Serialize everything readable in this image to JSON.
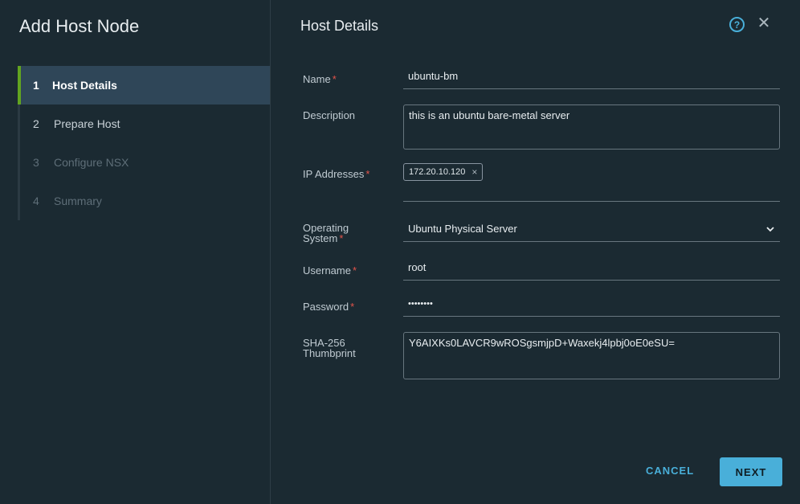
{
  "wizard": {
    "title": "Add Host Node",
    "steps": [
      {
        "num": "1",
        "label": "Host Details"
      },
      {
        "num": "2",
        "label": "Prepare Host"
      },
      {
        "num": "3",
        "label": "Configure NSX"
      },
      {
        "num": "4",
        "label": "Summary"
      }
    ]
  },
  "page": {
    "title": "Host Details",
    "help_glyph": "?",
    "close_glyph": "✕"
  },
  "form": {
    "name": {
      "label": "Name",
      "value": "ubuntu-bm",
      "required": "*"
    },
    "description": {
      "label": "Description",
      "value": "this is an ubuntu bare-metal server"
    },
    "ip_addresses": {
      "label": "IP Addresses",
      "required": "*",
      "chips": [
        "172.20.10.120"
      ],
      "chip_remove": "×"
    },
    "operating_system": {
      "label_line1": "Operating",
      "label_line2": "System",
      "required": "*",
      "value": "Ubuntu Physical Server",
      "chevron": "⌄"
    },
    "username": {
      "label": "Username",
      "value": "root",
      "required": "*"
    },
    "password": {
      "label": "Password",
      "value": "••••••••",
      "required": "*"
    },
    "thumbprint": {
      "label_line1": "SHA-256",
      "label_line2": "Thumbprint",
      "value": "Y6AIXKs0LAVCR9wROSgsmjpD+Waxekj4lpbj0oE0eSU="
    }
  },
  "actions": {
    "cancel": "CANCEL",
    "next": "NEXT"
  },
  "colors": {
    "background": "#1b2a32",
    "accent": "#49afd9",
    "active_step_bar": "#62a420",
    "required": "#e2534a"
  }
}
